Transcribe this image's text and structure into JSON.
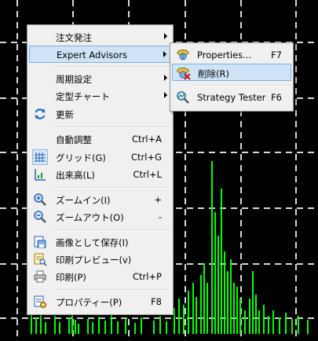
{
  "colors": {
    "chart_background": "#000000",
    "grid": "#d8d8d8",
    "volume_bars": "#00ff00",
    "menu_background": "#f0f0f0",
    "highlight": "#cfe3f7",
    "highlight_border": "#7fb0e2"
  },
  "context_menu": {
    "items": [
      {
        "label": "注文発注",
        "shortcut": "",
        "submenu": true,
        "icon": ""
      },
      {
        "label": "Expert Advisors",
        "shortcut": "",
        "submenu": true,
        "icon": "",
        "highlighted": true
      },
      {
        "label": "周期設定",
        "shortcut": "",
        "submenu": true,
        "icon": ""
      },
      {
        "label": "定型チャート",
        "shortcut": "",
        "submenu": true,
        "icon": ""
      },
      {
        "label": "更新",
        "shortcut": "",
        "submenu": false,
        "icon": "refresh-icon"
      },
      {
        "label": "自動調整",
        "shortcut": "Ctrl+A",
        "submenu": false,
        "icon": ""
      },
      {
        "label": "グリッド(G)",
        "shortcut": "Ctrl+G",
        "submenu": false,
        "icon": "grid-icon"
      },
      {
        "label": "出来高(L)",
        "shortcut": "Ctrl+L",
        "submenu": false,
        "icon": "volume-icon"
      },
      {
        "label": "ズームイン(I)",
        "shortcut": "+",
        "submenu": false,
        "icon": "zoom-in-icon"
      },
      {
        "label": "ズームアウト(O)",
        "shortcut": "-",
        "submenu": false,
        "icon": "zoom-out-icon"
      },
      {
        "label": "画像として保存(I)",
        "shortcut": "",
        "submenu": false,
        "icon": "save-image-icon"
      },
      {
        "label": "印刷プレビュー(v)",
        "shortcut": "",
        "submenu": false,
        "icon": "print-preview-icon"
      },
      {
        "label": "印刷(P)",
        "shortcut": "Ctrl+P",
        "submenu": false,
        "icon": "printer-icon"
      },
      {
        "label": "プロパティー(P)",
        "shortcut": "F8",
        "submenu": false,
        "icon": "properties-icon"
      }
    ]
  },
  "submenu": {
    "items": [
      {
        "label": "Properties...",
        "shortcut": "F7",
        "icon": "expert-properties-icon"
      },
      {
        "label": "削除(R)",
        "shortcut": "",
        "icon": "expert-remove-icon",
        "highlighted": true
      },
      {
        "label": "Strategy Tester",
        "shortcut": "F6",
        "icon": "strategy-tester-icon"
      }
    ]
  }
}
